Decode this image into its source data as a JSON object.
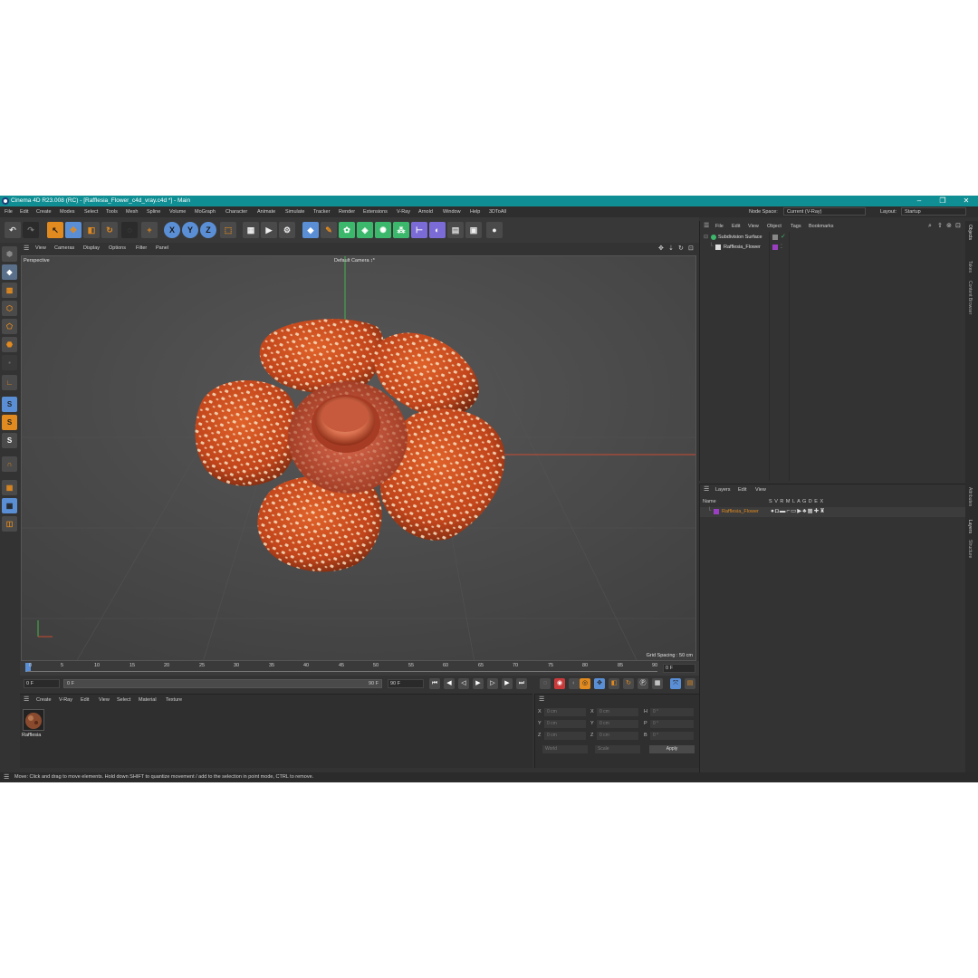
{
  "window": {
    "title": "Cinema 4D R23.008 (RC) - [Rafflesia_Flower_c4d_vray.c4d *] - Main",
    "minimize": "–",
    "maximize": "❐",
    "close": "✕"
  },
  "menubar": {
    "items": [
      "File",
      "Edit",
      "Create",
      "Modes",
      "Select",
      "Tools",
      "Mesh",
      "Spline",
      "Volume",
      "MoGraph",
      "Character",
      "Animate",
      "Simulate",
      "Tracker",
      "Render",
      "Extensions",
      "V-Ray",
      "Arnold",
      "Window",
      "Help",
      "3DToAll"
    ],
    "node_space_label": "Node Space:",
    "node_space_value": "Current (V-Ray)",
    "layout_label": "Layout:",
    "layout_value": "Startup"
  },
  "toolbar": {
    "axis_x": "X",
    "axis_y": "Y",
    "axis_z": "Z"
  },
  "lefttools": {
    "s1": "S",
    "s2": "S",
    "s3": "S"
  },
  "viewport": {
    "menu": [
      "View",
      "Cameras",
      "Display",
      "Options",
      "Filter",
      "Panel"
    ],
    "mode_label": "Perspective",
    "camera_label": "Default Camera ↕*",
    "grid_spacing": "Grid Spacing : 50 cm"
  },
  "timeline": {
    "ticks": [
      "0",
      "5",
      "10",
      "15",
      "20",
      "25",
      "30",
      "35",
      "40",
      "45",
      "50",
      "55",
      "60",
      "65",
      "70",
      "75",
      "80",
      "85",
      "90"
    ],
    "current_frame_right": "0 F",
    "start_field": "0 F",
    "range_start": "0 F",
    "range_end": "90 F",
    "end_field": "90 F"
  },
  "material": {
    "menu": [
      "Create",
      "V-Ray",
      "Edit",
      "View",
      "Select",
      "Material",
      "Texture"
    ],
    "item_name": "Rafflesia"
  },
  "coordinates": {
    "rows": [
      {
        "a": "X",
        "av": "0 cm",
        "b": "X",
        "bv": "0 cm",
        "c": "H",
        "cv": "0 °"
      },
      {
        "a": "Y",
        "av": "0 cm",
        "b": "Y",
        "bv": "0 cm",
        "c": "P",
        "cv": "0 °"
      },
      {
        "a": "Z",
        "av": "0 cm",
        "b": "Z",
        "bv": "0 cm",
        "c": "B",
        "cv": "0 °"
      }
    ],
    "mode_world": "World",
    "mode_scale": "Scale",
    "apply": "Apply"
  },
  "objects": {
    "menu": [
      "File",
      "Edit",
      "View",
      "Object",
      "Tags",
      "Bookmarks"
    ],
    "items": [
      "Subdivision Surface",
      "Rafflesia_Flower"
    ]
  },
  "layers": {
    "menu": [
      "Layers",
      "Edit",
      "View"
    ],
    "header_name": "Name",
    "header_cols": "S V R M L A G D E X",
    "item": "Rafflesia_Flower"
  },
  "sidetabs": [
    "Objects",
    "Takes",
    "Content Browser",
    "Attributes",
    "Layers",
    "Structure"
  ],
  "status": "Move: Click and drag to move elements. Hold down SHIFT to quantize movement / add to the selection in point mode, CTRL to remove.",
  "colors": {
    "title_bar": "#0f8e93",
    "accent_orange": "#e18a1f",
    "accent_blue": "#5a8fd6",
    "layer_color": "#9b3fc2"
  }
}
